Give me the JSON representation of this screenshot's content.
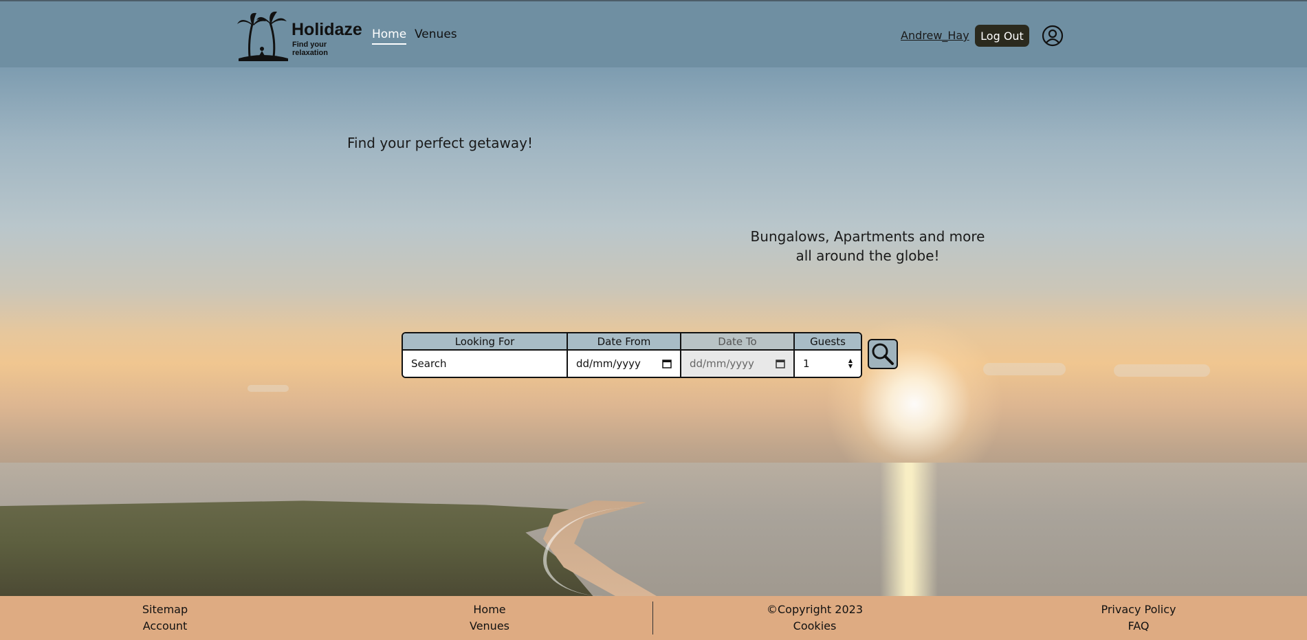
{
  "header": {
    "logo_title": "Holidaze",
    "logo_tagline": "Find your relaxation",
    "nav": [
      {
        "label": "Home",
        "active": true
      },
      {
        "label": "Venues",
        "active": false
      }
    ],
    "username": "Andrew_Hay",
    "logout_label": "Log Out",
    "profile_icon": "user-circle-icon"
  },
  "hero": {
    "tagline": "Find your perfect getaway!",
    "subtitle_line1": "Bungalows, Apartments and more",
    "subtitle_line2": "all around the globe!"
  },
  "search": {
    "looking_for_label": "Looking For",
    "looking_for_placeholder": "Search",
    "date_from_label": "Date From",
    "date_from_placeholder": "dd/mm/yyyy",
    "date_to_label": "Date To",
    "date_to_placeholder": "dd/mm/yyyy",
    "guests_label": "Guests",
    "guests_value": "1",
    "search_icon": "magnifier-icon"
  },
  "footer": {
    "col1": [
      "Sitemap",
      "Account"
    ],
    "col2": [
      "Home",
      "Venues"
    ],
    "col3": [
      "©Copyright 2023",
      "Cookies"
    ],
    "col4": [
      "Privacy Policy",
      "FAQ"
    ]
  },
  "colors": {
    "header_bg": "#6f8fa2",
    "footer_bg": "#deab82",
    "logout_bg": "#2b2a1e",
    "field_label_bg": "#a8bcc6"
  }
}
